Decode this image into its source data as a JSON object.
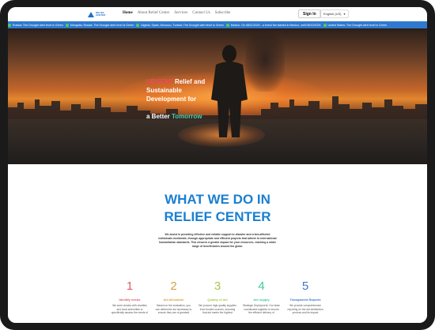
{
  "header": {
    "logo_text": "RELIEF CENTER",
    "menu": [
      "Home",
      "About Relief Center",
      "Services",
      "Contact Us",
      "Subscribe"
    ],
    "sign_in": "Sign In",
    "language": "English (US)"
  },
  "ticker": [
    "Russia: The Drought alert level is Green",
    "Mongolia, Russia: The Drought alert level is Green",
    "Algeria, Spain, Morocco, Tunisia: The Drought alert level is Green",
    "Mexico: On 08/11/2024 - a forest fire started in Mexico, until 08/12/2024",
    "United States: The Drought alert level is Green"
  ],
  "hero": {
    "line1_highlight": "URGENT",
    "line1_rest": " Relief and",
    "line2": "Sustainable",
    "line3": "Development for",
    "line4_prefix": "a Better ",
    "line4_highlight": "Tomorrow"
  },
  "section": {
    "heading_line1": "WHAT WE DO IN",
    "heading_line2": "RELIEF CENTER",
    "description": "We assist in providing effective and reliable support to disaster and crisis-affected individuals worldwide, through appropriate and efficient projects that adhere to international humanitarian standards. This ensures a greater impact for your resources, reaching a wider range of beneficiaries around the globe."
  },
  "steps": [
    {
      "number": "1",
      "title": "Identify needs",
      "text": "We work closely with charities and local authorities to specifically assess the needs of",
      "color": "#e05a6a"
    },
    {
      "number": "2",
      "title": "Aid allocation",
      "text": "Based on the evaluation, you can determine aid necessary to ensure they are of greatest",
      "color": "#d9a04a"
    },
    {
      "number": "3",
      "title": "Quality of aid",
      "text": "We procure high-quality supplies from trusted sources, ensuring that aid meets the highest",
      "color": "#a8c84a"
    },
    {
      "number": "4",
      "title": "Aid supply",
      "text": "Strategic Deployment: Our team coordinates logistics to ensure the efficient delivery of",
      "color": "#3fc9a0"
    },
    {
      "number": "5",
      "title": "Transparent Reports",
      "text": "We provide comprehensive reporting on the aid distribution process and its impact",
      "color": "#3a7ad1"
    }
  ]
}
